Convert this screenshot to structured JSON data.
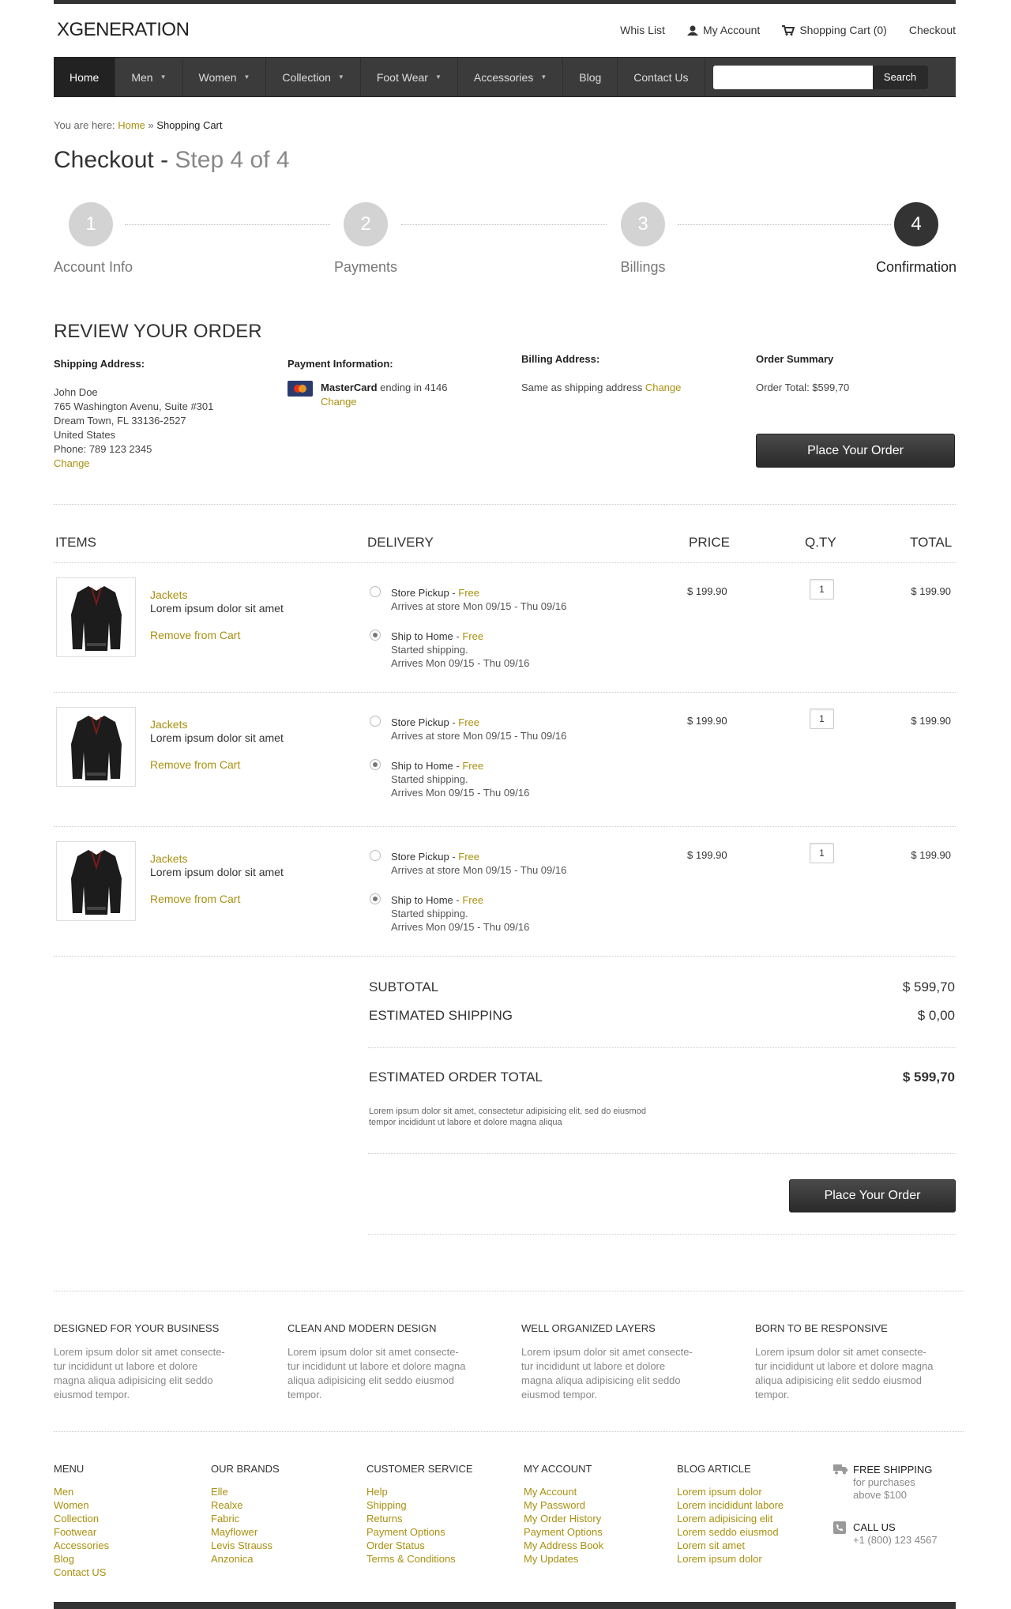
{
  "brand": "XGENERATION",
  "toplinks": {
    "wishlist": "Whis List",
    "account": "My Account",
    "cart": "Shopping Cart (0)",
    "checkout": "Checkout"
  },
  "nav": {
    "items": [
      "Home",
      "Men",
      "Women",
      "Collection",
      "Foot Wear",
      "Accessories",
      "Blog",
      "Contact Us"
    ],
    "search_button": "Search"
  },
  "breadcrumb": {
    "prefix": "You are here:",
    "home": "Home",
    "sep": "»",
    "current": "Shopping Cart"
  },
  "title": {
    "main": "Checkout -",
    "sub": "Step 4 of 4"
  },
  "steps": [
    {
      "num": "1",
      "label": "Account Info"
    },
    {
      "num": "2",
      "label": "Payments"
    },
    {
      "num": "3",
      "label": "Billings"
    },
    {
      "num": "4",
      "label": "Confirmation"
    }
  ],
  "review": {
    "heading": "REVIEW YOUR ORDER",
    "shipping": {
      "title": "Shipping Address:",
      "name": "John Doe",
      "line1": "765 Washington Avenu, Suite #301",
      "line2": "Dream Town, FL 33136-2527",
      "country": "United States",
      "phone": "Phone: 789 123 2345",
      "change": "Change"
    },
    "payment": {
      "title": "Payment Information:",
      "card": "MasterCard",
      "ending": "ending in 4146",
      "change": "Change"
    },
    "billing": {
      "title": "Billing Address:",
      "text": "Same as shipping address",
      "change": "Change"
    },
    "summary": {
      "title": "Order Summary",
      "total": "Order Total: $599,70",
      "button": "Place Your Order"
    }
  },
  "table": {
    "headers": {
      "items": "ITEMS",
      "delivery": "DELIVERY",
      "price": "PRICE",
      "qty": "Q.TY",
      "total": "TOTAL"
    },
    "rows": [
      {
        "category": "Jackets",
        "desc": "Lorem ipsum dolor sit amet",
        "remove": "Remove from Cart",
        "pickup": "Store Pickup",
        "pickup_free": "Free",
        "pickup_arrive": "Arrives at store Mon 09/15 - Thu 09/16",
        "ship": "Ship to Home",
        "ship_free": "Free",
        "ship_status": "Started shipping.",
        "ship_arrive": "Arrives Mon 09/15 - Thu 09/16",
        "price": "$ 199.90",
        "qty": "1",
        "total": "$ 199.90"
      },
      {
        "category": "Jackets",
        "desc": "Lorem ipsum dolor sit amet",
        "remove": "Remove from Cart",
        "pickup": "Store Pickup",
        "pickup_free": "Free",
        "pickup_arrive": "Arrives at store Mon 09/15 - Thu 09/16",
        "ship": "Ship to Home",
        "ship_free": "Free",
        "ship_status": "Started shipping.",
        "ship_arrive": "Arrives Mon 09/15 - Thu 09/16",
        "price": "$ 199.90",
        "qty": "1",
        "total": "$ 199.90"
      },
      {
        "category": "Jackets",
        "desc": "Lorem ipsum dolor sit amet",
        "remove": "Remove from Cart",
        "pickup": "Store Pickup",
        "pickup_free": "Free",
        "pickup_arrive": "Arrives at store Mon 09/15 - Thu 09/16",
        "ship": "Ship to Home",
        "ship_free": "Free",
        "ship_status": "Started shipping.",
        "ship_arrive": "Arrives Mon 09/15 - Thu 09/16",
        "price": "$ 199.90",
        "qty": "1",
        "total": "$ 199.90"
      }
    ]
  },
  "totals": {
    "subtotal_label": "SUBTOTAL",
    "subtotal": "$ 599,70",
    "shipping_label": "ESTIMATED SHIPPING",
    "shipping": "$ 0,00",
    "order_label": "ESTIMATED ORDER TOTAL",
    "order": "$ 599,70",
    "note1": "Lorem ipsum dolor sit amet, consectetur adipisicing elit, sed do eiusmod",
    "note2": "tempor incididunt ut labore et dolore magna aliqua",
    "button": "Place Your Order"
  },
  "features": [
    {
      "title": "DESIGNED FOR YOUR BUSINESS",
      "lines": [
        "Lorem ipsum dolor sit amet consecte-",
        "tur incididunt ut labore et dolore",
        "magna aliqua adipisicing elit seddo",
        "eiusmod tempor."
      ]
    },
    {
      "title": "CLEAN AND MODERN DESIGN",
      "lines": [
        "Lorem ipsum dolor sit amet consecte-",
        "tur incididunt ut labore et dolore magna",
        "aliqua adipisicing elit seddo eiusmod",
        "tempor."
      ]
    },
    {
      "title": "WELL ORGANIZED LAYERS",
      "lines": [
        "Lorem ipsum dolor sit amet consecte-",
        "tur incididunt ut labore et dolore",
        "magna aliqua adipisicing elit seddo",
        "eiusmod tempor."
      ]
    },
    {
      "title": "BORN TO BE RESPONSIVE",
      "lines": [
        "Lorem ipsum dolor sit amet consecte-",
        "tur incididunt ut labore et dolore magna",
        "aliqua adipisicing elit seddo eiusmod",
        "tempor."
      ]
    }
  ],
  "footer": {
    "menu": {
      "title": "MENU",
      "items": [
        "Men",
        "Women",
        "Collection",
        "Footwear",
        "Accessories",
        "Blog",
        "Contact US"
      ]
    },
    "brands": {
      "title": "OUR BRANDS",
      "items": [
        "Elle",
        "Realxe",
        "Fabric",
        "Mayflower",
        "Levis Strauss",
        "Anzonica"
      ]
    },
    "service": {
      "title": "CUSTOMER SERVICE",
      "items": [
        "Help",
        "Shipping",
        "Returns",
        "Payment Options",
        "Order Status",
        "Terms & Conditions"
      ]
    },
    "account": {
      "title": "MY ACCOUNT",
      "items": [
        "My Account",
        "My Password",
        "My Order History",
        "Payment Options",
        "My Address Book",
        "My Updates"
      ]
    },
    "blog": {
      "title": "BLOG ARTICLE",
      "items": [
        "Lorem ipsum dolor",
        "Lorem incididunt labore",
        "Lorem adipisicing elit",
        "Lorem seddo eiusmod",
        "Lorem sit amet",
        "Lorem ipsum dolor"
      ]
    },
    "shipping_title": "FREE SHIPPING",
    "shipping_l1": "for purchases",
    "shipping_l2": "above $100",
    "call_title": "CALL US",
    "call_number": "+1 (800) 123 4567"
  },
  "colors": {
    "accent": "#a8900f",
    "nav_bg": "#3b3b3b",
    "step_done": "#333333",
    "step_pending": "#d3d3d3"
  }
}
